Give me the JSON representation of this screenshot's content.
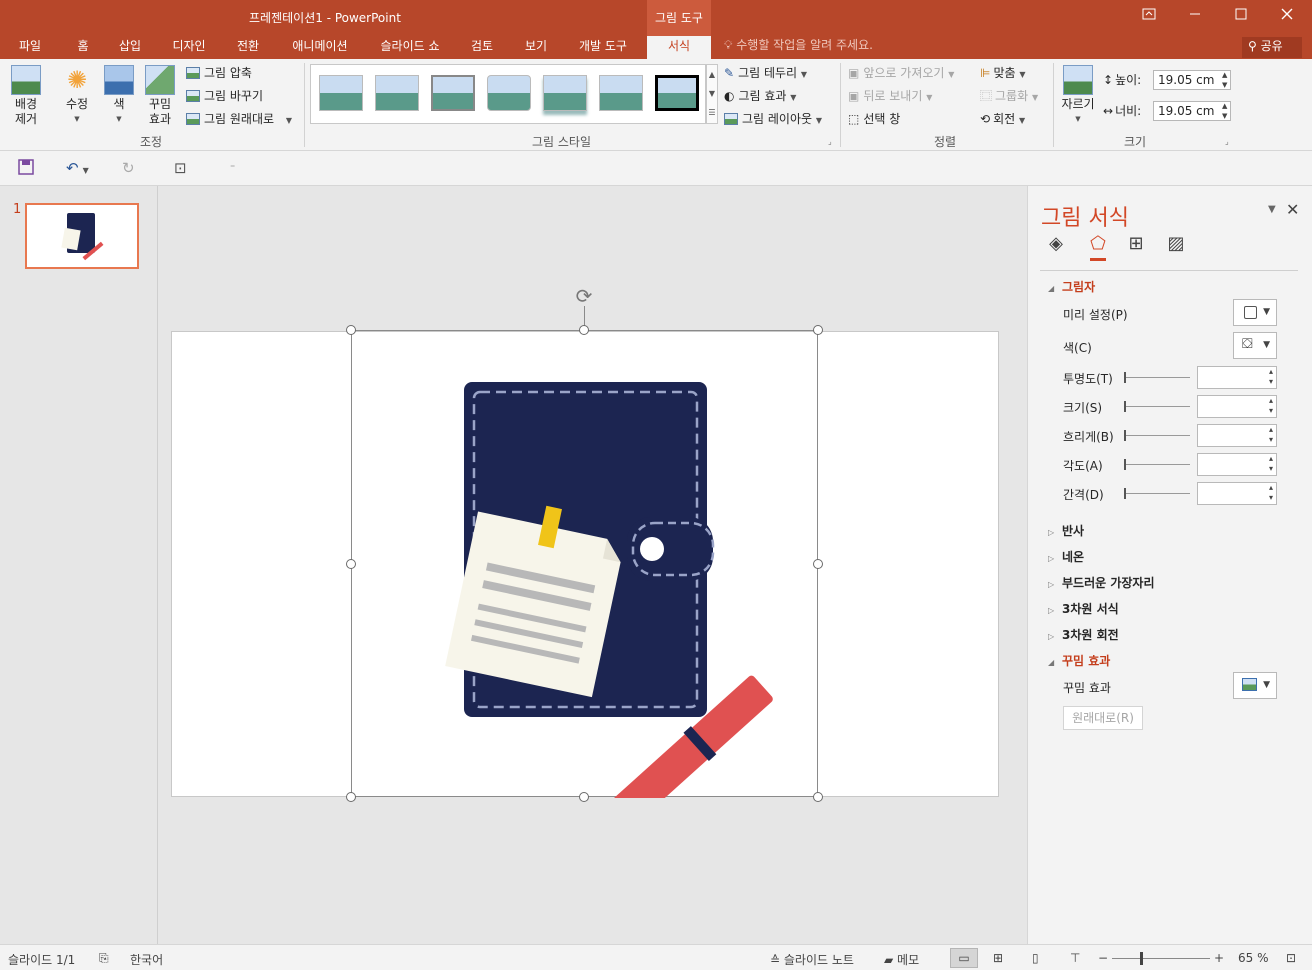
{
  "window": {
    "title": "프레젠테이션1 - PowerPoint",
    "context_group": "그림 도구",
    "minimize_icon": "minimize-icon",
    "restore_icon": "restore-icon",
    "close_icon": "close-icon"
  },
  "tabs": [
    "파일",
    "홈",
    "삽입",
    "디자인",
    "전환",
    "애니메이션",
    "슬라이드 쇼",
    "검토",
    "보기",
    "개발 도구",
    "서식"
  ],
  "active_tab": "서식",
  "tell_me": "수행할 작업을 알려 주세요.",
  "share": "공유",
  "ribbon": {
    "adjust": {
      "remove_bg": [
        "배경",
        "제거"
      ],
      "corrections": "수정",
      "color": "색",
      "artistic": [
        "꾸밈",
        "효과"
      ],
      "compress": "그림 압축",
      "change": "그림 바꾸기",
      "reset": "그림 원래대로",
      "label": "조정"
    },
    "styles": {
      "label": "그림 스타일",
      "border": "그림 테두리",
      "effects": "그림 효과",
      "layout": "그림 레이아웃"
    },
    "arrange": {
      "label": "정렬",
      "bring_forward": "앞으로 가져오기",
      "send_backward": "뒤로 보내기",
      "selection_pane": "선택 창",
      "align": "맞춤",
      "group": "그룹화",
      "rotate": "회전"
    },
    "size": {
      "label": "크기",
      "crop": "자르기",
      "height_label": "높이:",
      "height_value": "19.05 cm",
      "width_label": "너비:",
      "width_value": "19.05 cm"
    }
  },
  "slides": {
    "current_number": "1"
  },
  "format_pane": {
    "title": "그림 서식",
    "shadow": {
      "heading": "그림자",
      "preset": "미리 설정(P)",
      "color": "색(C)",
      "transparency": "투명도(T)",
      "size": "크기(S)",
      "blur": "흐리게(B)",
      "angle": "각도(A)",
      "distance": "간격(D)"
    },
    "collapsed_sections": [
      "반사",
      "네온",
      "부드러운 가장자리",
      "3차원 서식",
      "3차원 회전"
    ],
    "artistic": {
      "heading": "꾸밈 효과",
      "label": "꾸밈 효과",
      "reset": "원래대로(R)"
    }
  },
  "status": {
    "slide": "슬라이드 1/1",
    "language": "한국어",
    "notes": "슬라이드 노트",
    "comments": "메모",
    "zoom": "65 %"
  },
  "colors": {
    "accent": "#b7472a",
    "pane_heading": "#c43e1c",
    "notebook": "#1c2551",
    "pen": "#e05151",
    "note": "#f7f5ea",
    "clip": "#f0c419"
  }
}
